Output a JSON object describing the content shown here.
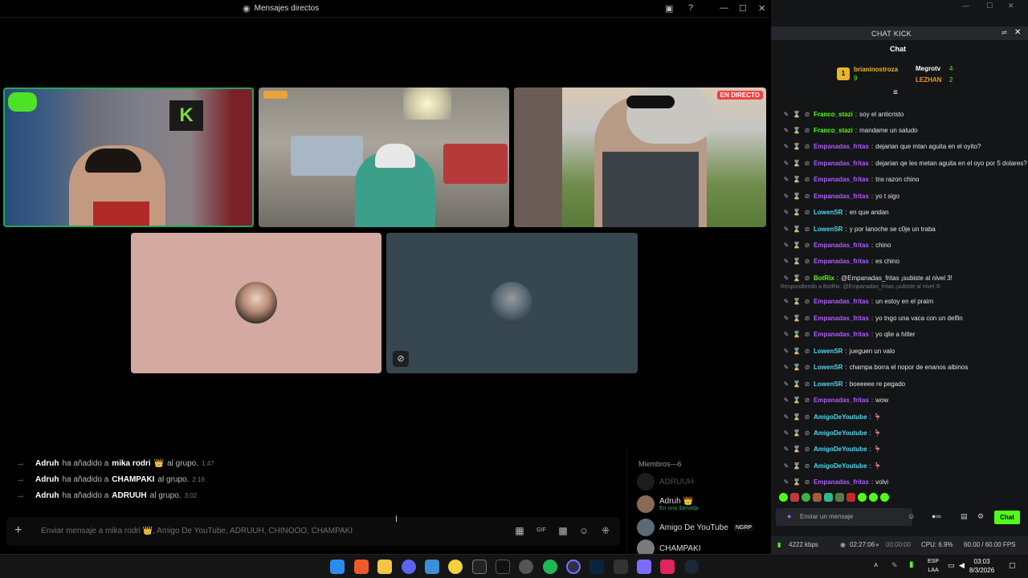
{
  "discord": {
    "window_title": "Mensajes directos",
    "live_badge": "EN DIRECTO",
    "system_messages": [
      {
        "actor": "Adruh",
        "action": "ha añadido a",
        "target": "mika rodri",
        "crown": "👑",
        "suffix": "al grupo.",
        "time": "1:47"
      },
      {
        "actor": "Adruh",
        "action": "ha añadido a",
        "target": "CHAMPAKI",
        "crown": "",
        "suffix": "al grupo.",
        "time": "2:16"
      },
      {
        "actor": "Adruh",
        "action": "ha añadido a",
        "target": "ADRUUH",
        "crown": "",
        "suffix": "al grupo.",
        "time": "3:02"
      }
    ],
    "input_placeholder": "Enviar mensaje a mika rodri 👑, Amigo De YouTube, ADRUUH, CHINOOO, CHAMPAKI",
    "members_header": "Miembros—6",
    "members": [
      {
        "name": "ADRUUH",
        "sub": "",
        "badge": ""
      },
      {
        "name": "Adruh 👑",
        "sub": "En una llamada",
        "badge": ""
      },
      {
        "name": "Amigo De YouTube",
        "sub": "",
        "badge": "NGRP"
      },
      {
        "name": "CHAMPAKI",
        "sub": "",
        "badge": ""
      }
    ],
    "colors": {
      "accent": "#23a55a",
      "live": "#ed4245",
      "tile_pink": "#d4a9a1",
      "tile_slate": "#37474f"
    }
  },
  "kick": {
    "window_title": "CHAT KICK",
    "chat_label": "Chat",
    "leaders": [
      {
        "rank": "1",
        "name": "brianinostroza",
        "count": "9"
      },
      {
        "name": "Megrotv",
        "count": "4"
      },
      {
        "name": "LEZHAN",
        "count": "2"
      }
    ],
    "messages": [
      {
        "user": "Franco_stazi",
        "color": "#53fc18",
        "text": "soy el anticristo"
      },
      {
        "user": "Franco_stazi",
        "color": "#53fc18",
        "text": "mandame un saludo"
      },
      {
        "user": "Empanadas_fritas",
        "color": "#b05cff",
        "text": "dejarian que mtan aguita en el oyito?"
      },
      {
        "user": "Empanadas_fritas",
        "color": "#b05cff",
        "text": "dejarian qe les metan aguita en el oyo por 5 dolares?"
      },
      {
        "user": "Empanadas_fritas",
        "color": "#b05cff",
        "text": "tns razon chino"
      },
      {
        "user": "Empanadas_fritas",
        "color": "#b05cff",
        "text": "yo t sigo"
      },
      {
        "user": "LowenSR",
        "color": "#4dd8f0",
        "text": "en que andan"
      },
      {
        "user": "LowenSR",
        "color": "#4dd8f0",
        "text": "y por lanoche se c0je un traba"
      },
      {
        "user": "Empanadas_fritas",
        "color": "#b05cff",
        "text": "chino"
      },
      {
        "user": "Empanadas_fritas",
        "color": "#b05cff",
        "text": "es chino"
      },
      {
        "user": "BotRix",
        "color": "#53fc18",
        "text": "@Empanadas_fritas ¡subiste al nivel 3!"
      },
      {
        "user": "Empanadas_fritas",
        "color": "#b05cff",
        "text": "un estoy en el praim"
      },
      {
        "user": "Empanadas_fritas",
        "color": "#b05cff",
        "text": "yo tngo una vaca con un delfin"
      },
      {
        "user": "Empanadas_fritas",
        "color": "#b05cff",
        "text": "yo qlie a hitler"
      },
      {
        "user": "LowenSR",
        "color": "#4dd8f0",
        "text": "jueguen un valo"
      },
      {
        "user": "LowenSR",
        "color": "#4dd8f0",
        "text": "champa borra el nopor de enanos albinos"
      },
      {
        "user": "LowenSR",
        "color": "#4dd8f0",
        "text": "boeeeee re pegado"
      },
      {
        "user": "Empanadas_fritas",
        "color": "#b05cff",
        "text": "wow"
      },
      {
        "user": "AmigoDeYoutube",
        "color": "#4dd8f0",
        "text": "🦩"
      },
      {
        "user": "AmigoDeYoutube",
        "color": "#4dd8f0",
        "text": "🦩"
      },
      {
        "user": "AmigoDeYoutube",
        "color": "#4dd8f0",
        "text": "🦩"
      },
      {
        "user": "AmigoDeYoutube",
        "color": "#4dd8f0",
        "text": "🦩"
      },
      {
        "user": "Empanadas_fritas",
        "color": "#b05cff",
        "text": "volvi"
      }
    ],
    "reply_note": "Respondiendo a BotRix: @Empanadas_fritas ¡subiste al nivel 3!",
    "input_placeholder": "Enviar un mensaje",
    "chat_button": "Chat"
  },
  "obs": {
    "bitrate": "4222 kbps",
    "stream_time": "02:27:06",
    "rec_time": "00:00:00",
    "cpu": "CPU: 6.9%",
    "fps": "60.00 / 60.00 FPS"
  },
  "taskbar": {
    "lang_top": "ESP",
    "lang_bottom": "LAA",
    "time": "03:03",
    "date": "8/3/2026"
  }
}
